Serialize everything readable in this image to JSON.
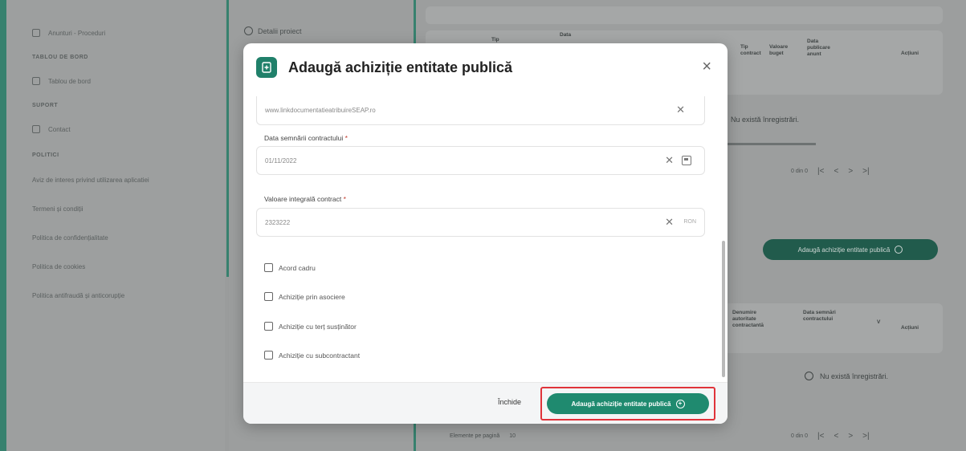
{
  "sidebar": {
    "items": [
      {
        "label": "Anunturi - Proceduri",
        "icon": "document-icon"
      },
      {
        "label": "TABLOU DE BORD",
        "section": true
      },
      {
        "label": "Tablou de bord",
        "icon": "dashboard-icon"
      },
      {
        "label": "SUPORT",
        "section": true
      },
      {
        "label": "Contact",
        "icon": "mail-icon"
      },
      {
        "label": "POLITICI",
        "section": true
      },
      {
        "label": "Aviz de interes privind utilizarea aplicatiei"
      },
      {
        "label": "Termeni și condiții"
      },
      {
        "label": "Politica de confidențialitate"
      },
      {
        "label": "Politica de cookies"
      },
      {
        "label": "Politica antifraudă și anticorupție"
      }
    ]
  },
  "middle": {
    "header": "Detalii proiect"
  },
  "background_table_top": {
    "headers": [
      "Tip",
      "Data",
      "Tip contract",
      "Valoare buget",
      "Data publicare anunt",
      "Acțiuni"
    ],
    "empty_text": "Nu există înregistrări."
  },
  "background_add_button": "Adaugă achiziție entitate publică",
  "background_table_bottom": {
    "headers": [
      "Denumire autoritate contractantă",
      "Data semnări contractului",
      "V",
      "Acțiuni"
    ],
    "empty_text": "Nu există înregistrări."
  },
  "pager": {
    "rows_per_page_label": "Elemente pe pagină",
    "rows_per_page": "10",
    "range": "0 din 0"
  },
  "modal": {
    "title": "Adaugă achiziție entitate publică",
    "close_symbol": "×",
    "fields": {
      "link": {
        "value": "www.linkdocumentatieatribuireSEAP.ro"
      },
      "sign_date": {
        "label": "Data semnării contractului",
        "value": "01/11/2022"
      },
      "contract_value": {
        "label": "Valoare integrală contract",
        "value": "2323222",
        "unit": "RON"
      }
    },
    "checkboxes": [
      {
        "label": "Acord cadru",
        "checked": false
      },
      {
        "label": "Achiziție prin asociere",
        "checked": false
      },
      {
        "label": "Achiziție cu terț susținător",
        "checked": false
      },
      {
        "label": "Achiziție cu subcontractant",
        "checked": false
      }
    ],
    "footer": {
      "close_label": "Închide",
      "submit_label": "Adaugă achiziție entitate publică"
    }
  },
  "colors": {
    "accent": "#1f8a6f",
    "highlight": "#e0333a"
  }
}
